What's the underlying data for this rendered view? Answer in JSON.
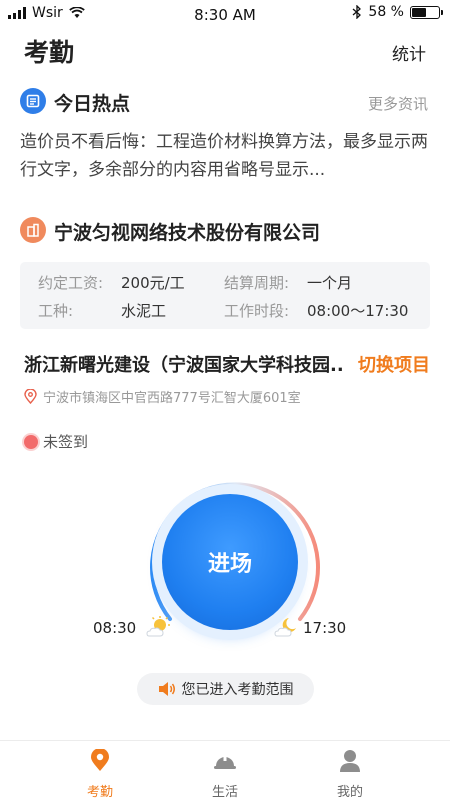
{
  "status_bar": {
    "carrier": "Wsir",
    "time": "8:30 AM",
    "battery_text": "58 %",
    "battery_level": 0.58
  },
  "header": {
    "title": "考勤",
    "stats_label": "统计"
  },
  "news": {
    "section_title": "今日热点",
    "more_label": "更多资讯",
    "body": "造价员不看后悔：工程造价材料换算方法，最多显示两行文字，多余部分的内容用省略号显示..."
  },
  "company": {
    "name": "宁波匀视网络技术股份有限公司",
    "info": {
      "wage_label": "约定工资:",
      "wage_value": "200元/工",
      "cycle_label": "结算周期:",
      "cycle_value": "一个月",
      "type_label": "工种:",
      "type_value": "水泥工",
      "hours_label": "工作时段:",
      "hours_value": "08:00～17:30"
    }
  },
  "project": {
    "name": "浙江新曙光建设（宁波国家大学科技园...",
    "switch_label": "切换项目",
    "address": "宁波市镇海区中官西路777号汇智大厦601室"
  },
  "attendance": {
    "state": "未签到",
    "button_label": "进场",
    "start_time": "08:30",
    "end_time": "17:30",
    "range_text": "您已进入考勤范围"
  },
  "tabbar": {
    "items": [
      {
        "label": "考勤",
        "icon": "location-pin-icon",
        "active": true
      },
      {
        "label": "生活",
        "icon": "hardhat-icon",
        "active": false
      },
      {
        "label": "我的",
        "icon": "user-icon",
        "active": false
      }
    ]
  },
  "colors": {
    "accent": "#f07c1e",
    "primary": "#1f7ff0",
    "alert": "#f26b6b"
  }
}
